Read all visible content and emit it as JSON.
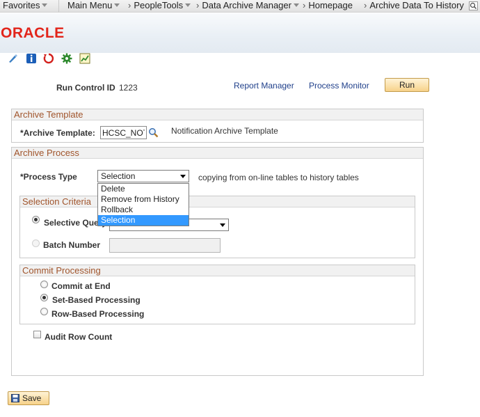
{
  "nav": {
    "favorites": "Favorites",
    "main_menu": "Main Menu",
    "breadcrumbs": [
      "PeopleTools",
      "Data Archive Manager",
      "Homepage",
      "Archive Data To History"
    ]
  },
  "header": {
    "logo": "ORACLE"
  },
  "run_control": {
    "label": "Run Control ID",
    "value": "1223",
    "report_manager": "Report Manager",
    "process_monitor": "Process Monitor",
    "run": "Run"
  },
  "archive_template": {
    "title": "Archive Template",
    "label": "*Archive Template:",
    "value": "HCSC_NOTIF",
    "description": "Notification Archive Template"
  },
  "archive_process": {
    "title": "Archive Process",
    "process_type_label": "*Process Type",
    "process_type_value": "Selection",
    "process_type_description": "copying from on-line tables to history tables",
    "process_type_options": [
      "Delete",
      "Remove from History",
      "Rollback",
      "Selection"
    ],
    "selection_criteria": {
      "title": "Selection Criteria",
      "selective_query_label": "Selective Query",
      "batch_number_label": "Batch Number"
    },
    "commit_processing": {
      "title": "Commit Processing",
      "options": [
        "Commit at End",
        "Set-Based Processing",
        "Row-Based Processing"
      ]
    },
    "audit_row_count_label": "Audit Row Count"
  },
  "footer": {
    "save": "Save"
  },
  "colors": {
    "oracle_red": "#e2251b",
    "group_title": "#a0542b",
    "link": "#1f3f8a",
    "dropdown_highlight": "#3399ff"
  }
}
